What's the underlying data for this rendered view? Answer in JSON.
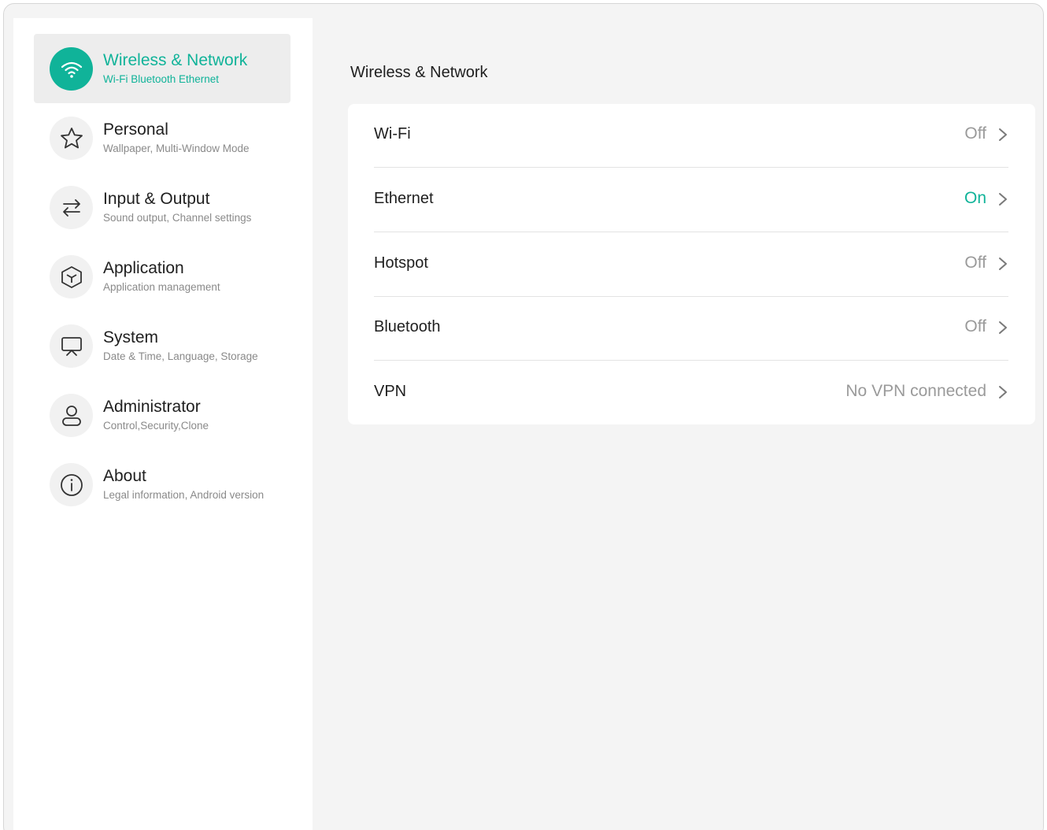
{
  "accent_color": "#10b399",
  "sidebar": {
    "items": [
      {
        "title": "Wireless & Network",
        "subtitle": "Wi-Fi Bluetooth Ethernet",
        "icon": "wifi-icon",
        "active": true
      },
      {
        "title": "Personal",
        "subtitle": "Wallpaper, Multi-Window Mode",
        "icon": "star-icon"
      },
      {
        "title": "Input & Output",
        "subtitle": "Sound output, Channel settings",
        "icon": "swap-arrows-icon"
      },
      {
        "title": "Application",
        "subtitle": "Application management",
        "icon": "cube-icon"
      },
      {
        "title": "System",
        "subtitle": "Date & Time, Language, Storage",
        "icon": "presentation-screen-icon"
      },
      {
        "title": "Administrator",
        "subtitle": "Control,Security,Clone",
        "icon": "user-icon"
      },
      {
        "title": "About",
        "subtitle": "Legal information, Android version",
        "icon": "info-icon"
      }
    ]
  },
  "main": {
    "title": "Wireless & Network",
    "rows": [
      {
        "label": "Wi-Fi",
        "value": "Off"
      },
      {
        "label": "Ethernet",
        "value": "On"
      },
      {
        "label": "Hotspot",
        "value": "Off"
      },
      {
        "label": "Bluetooth",
        "value": "Off"
      },
      {
        "label": "VPN",
        "value": "No VPN connected"
      }
    ]
  }
}
